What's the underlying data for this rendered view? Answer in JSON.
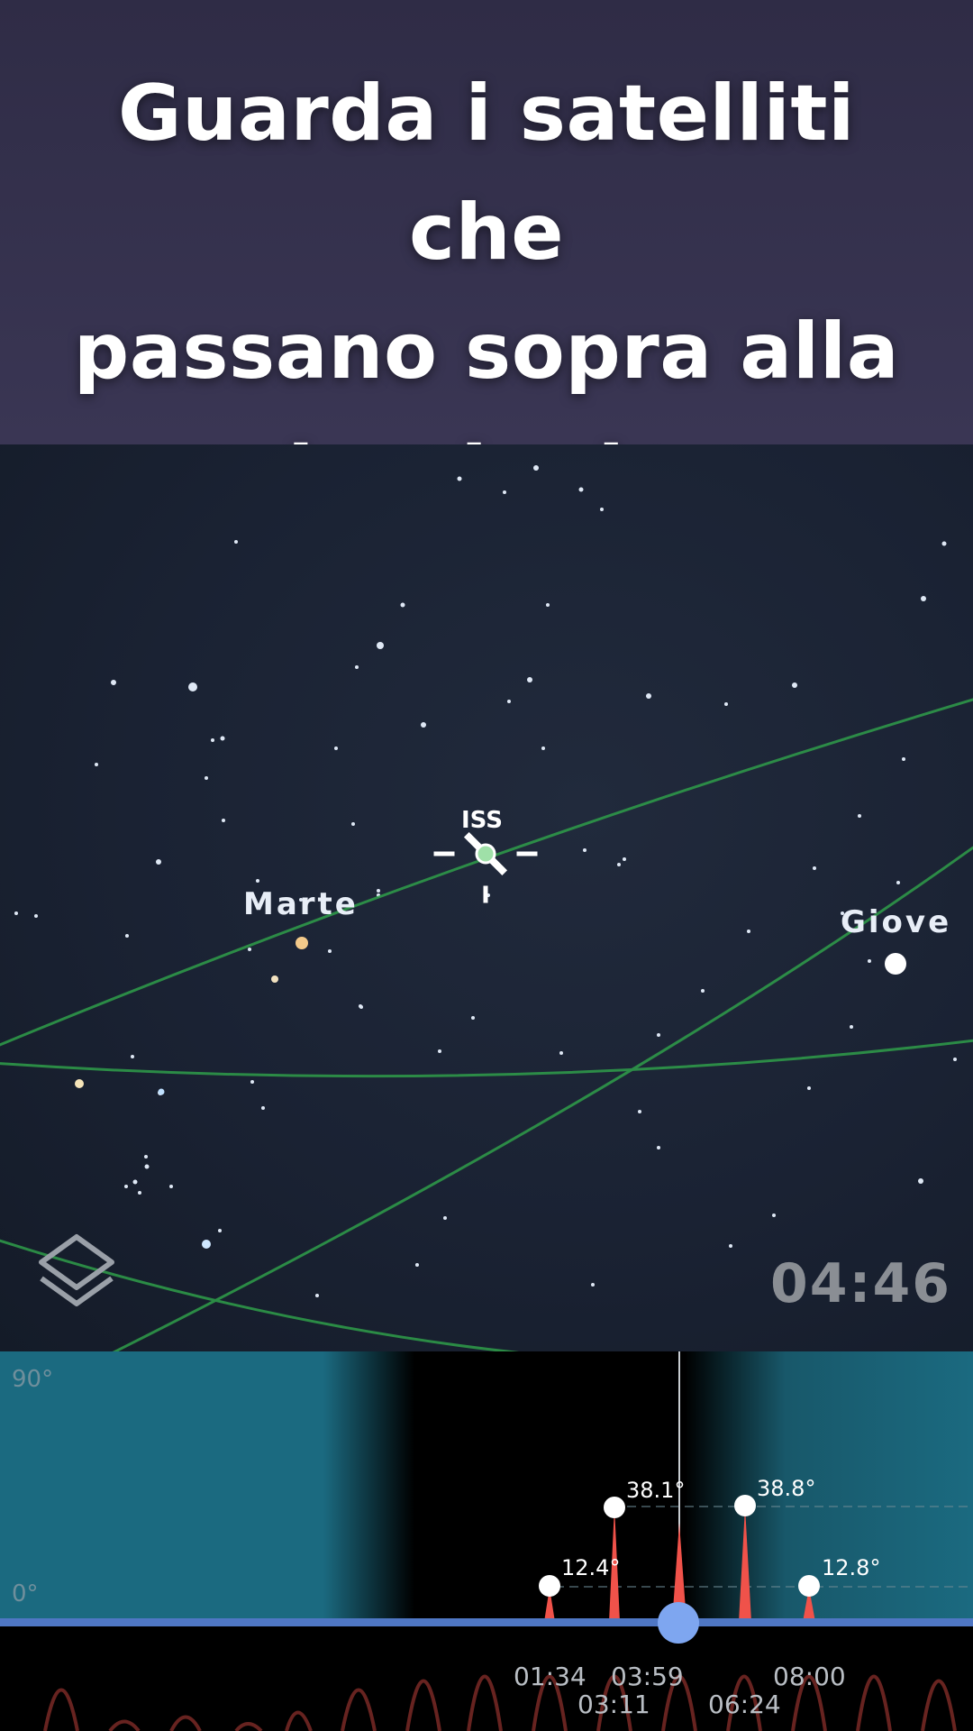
{
  "header": {
    "lines": [
      "Guarda i satelliti che",
      "passano sopra alla",
      "tua testa"
    ]
  },
  "sky": {
    "iss_label": "ISS",
    "planets": {
      "mars": "Marte",
      "jupiter": "Giove"
    },
    "current_time": "04:46",
    "layers_icon": "layers-icon",
    "colors": {
      "orbit": "#2f9e4a",
      "mars": "#f3c98a",
      "jupiter": "#ffffff"
    }
  },
  "timeline": {
    "axis_max": "90°",
    "axis_min": "0°",
    "passes": [
      {
        "max_alt": "12.4°",
        "time": "01:34"
      },
      {
        "max_alt": "38.1°",
        "time": "03:11"
      },
      {
        "max_alt": "",
        "time": "03:59"
      },
      {
        "max_alt": "38.8°",
        "time": "06:24"
      },
      {
        "max_alt": "12.8°",
        "time": "08:00"
      }
    ],
    "colors": {
      "day": "#1b6a80",
      "pass": "#f0524a",
      "track": "#4f77c4",
      "scrubber": "#7ea6f0"
    }
  }
}
